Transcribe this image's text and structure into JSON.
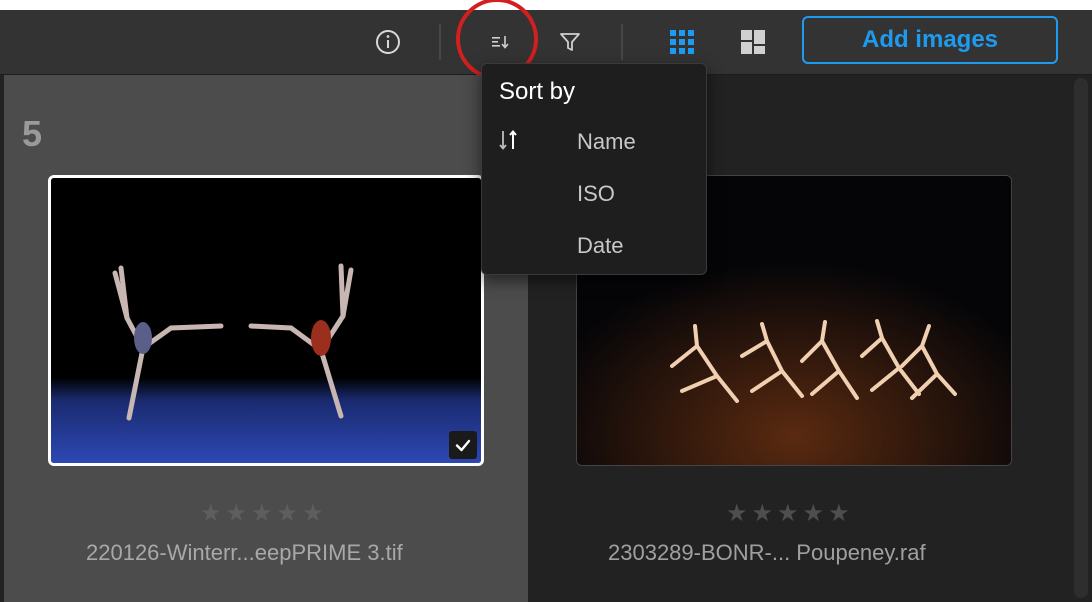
{
  "toolbar": {
    "add_images_label": "Add images",
    "icons": [
      "info-icon",
      "sort-icon",
      "filter-icon",
      "grid-view-icon",
      "mosaic-view-icon"
    ],
    "accent_color": "#1e9bef"
  },
  "sort_menu": {
    "title": "Sort by",
    "items": [
      {
        "label": "Name",
        "active": true,
        "direction_icon": "sort-direction-icon"
      },
      {
        "label": "ISO",
        "active": false
      },
      {
        "label": "Date",
        "active": false
      }
    ]
  },
  "group": {
    "number": "5"
  },
  "images": [
    {
      "filename": "220126-Winterr...eepPRIME 3.tif",
      "selected": true,
      "rating": "★★★★★"
    },
    {
      "filename": "2303289-BONR-... Poupeney.raf",
      "selected": false,
      "rating": "★★★★★"
    }
  ],
  "annotation": {
    "highlight_color": "#d21f1f"
  }
}
